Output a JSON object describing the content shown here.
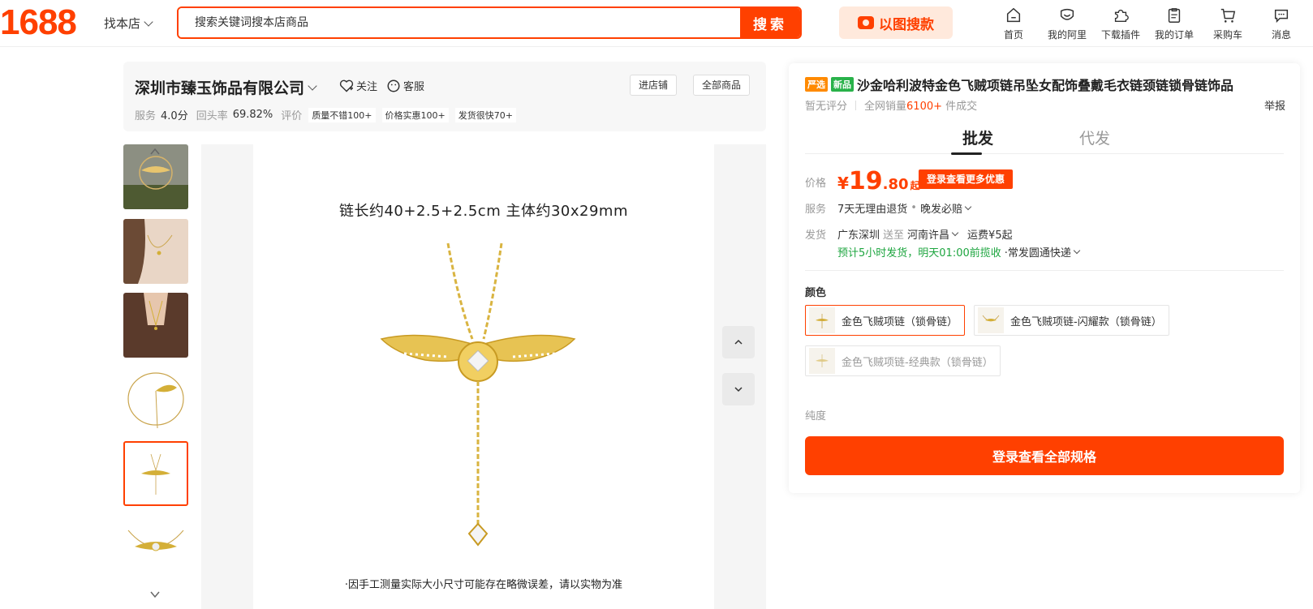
{
  "header": {
    "logo": "1688",
    "store_select": "找本店",
    "search_placeholder": "搜索关键词搜本店商品",
    "search_button": "搜索",
    "image_search": "以图搜款",
    "nav": [
      {
        "label": "首页",
        "icon": "home-icon"
      },
      {
        "label": "我的阿里",
        "icon": "user-heart-icon"
      },
      {
        "label": "下载插件",
        "icon": "puzzle-icon"
      },
      {
        "label": "我的订单",
        "icon": "order-icon"
      },
      {
        "label": "采购车",
        "icon": "cart-icon"
      },
      {
        "label": "消息",
        "icon": "message-icon"
      }
    ]
  },
  "shop": {
    "name": "深圳市臻玉饰品有限公司",
    "follow": "关注",
    "service": "客服",
    "enter_shop": "进店铺",
    "all_products": "全部商品",
    "stats": {
      "service_label": "服务",
      "service_value": "4.0分",
      "repurchase_label": "回头率",
      "repurchase_value": "69.82%",
      "review_label": "评价",
      "tags": [
        "质量不错100+",
        "价格实惠100+",
        "发货很快70+"
      ]
    }
  },
  "gallery": {
    "caption_top": "链长约40+2.5+2.5cm 主体约30x29mm",
    "caption_bottom": "·因手工测量实际大小尺寸可能存在略微误差，请以实物为准",
    "active_thumb": 4
  },
  "product": {
    "badges": [
      "严选",
      "新品"
    ],
    "badge_colors": [
      "#ff8a00",
      "#29b24a"
    ],
    "title": "沙金哈利波特金色飞贼项链吊坠女配饰叠戴毛衣链颈链锁骨链饰品",
    "rating": "暂无评分",
    "sales_prefix": "全网销量",
    "sales_value": "6100+",
    "sales_suffix": "件成交",
    "report": "举报",
    "tabs": [
      "批发",
      "代发"
    ],
    "price_label": "价格",
    "price_currency": "¥",
    "price_int": "19",
    "price_dec": ".80",
    "price_suffix": "起",
    "login_discount": "登录查看更多优惠",
    "service_label": "服务",
    "service_value": "7天无理由退货",
    "service_extra": "晚发必赔",
    "shipping_label": "发货",
    "ship_from": "广东深圳",
    "ship_to_word": "送至",
    "ship_to": "河南许昌",
    "freight": "运费¥5起",
    "ship_estimate": "预计5小时发货，明天01:00前揽收",
    "courier": "·常发圆通快递",
    "color_label": "颜色",
    "skus": [
      {
        "label": "金色飞贼项链（锁骨链）",
        "state": "selected"
      },
      {
        "label": "金色飞贼项链-闪耀款（锁骨链）",
        "state": "normal"
      },
      {
        "label": "金色飞贼项链-经典款（锁骨链）",
        "state": "disabled"
      }
    ],
    "purity_label": "纯度",
    "cta": "登录查看全部规格"
  },
  "colors": {
    "brand": "#ff4000",
    "green": "#1da53f"
  }
}
